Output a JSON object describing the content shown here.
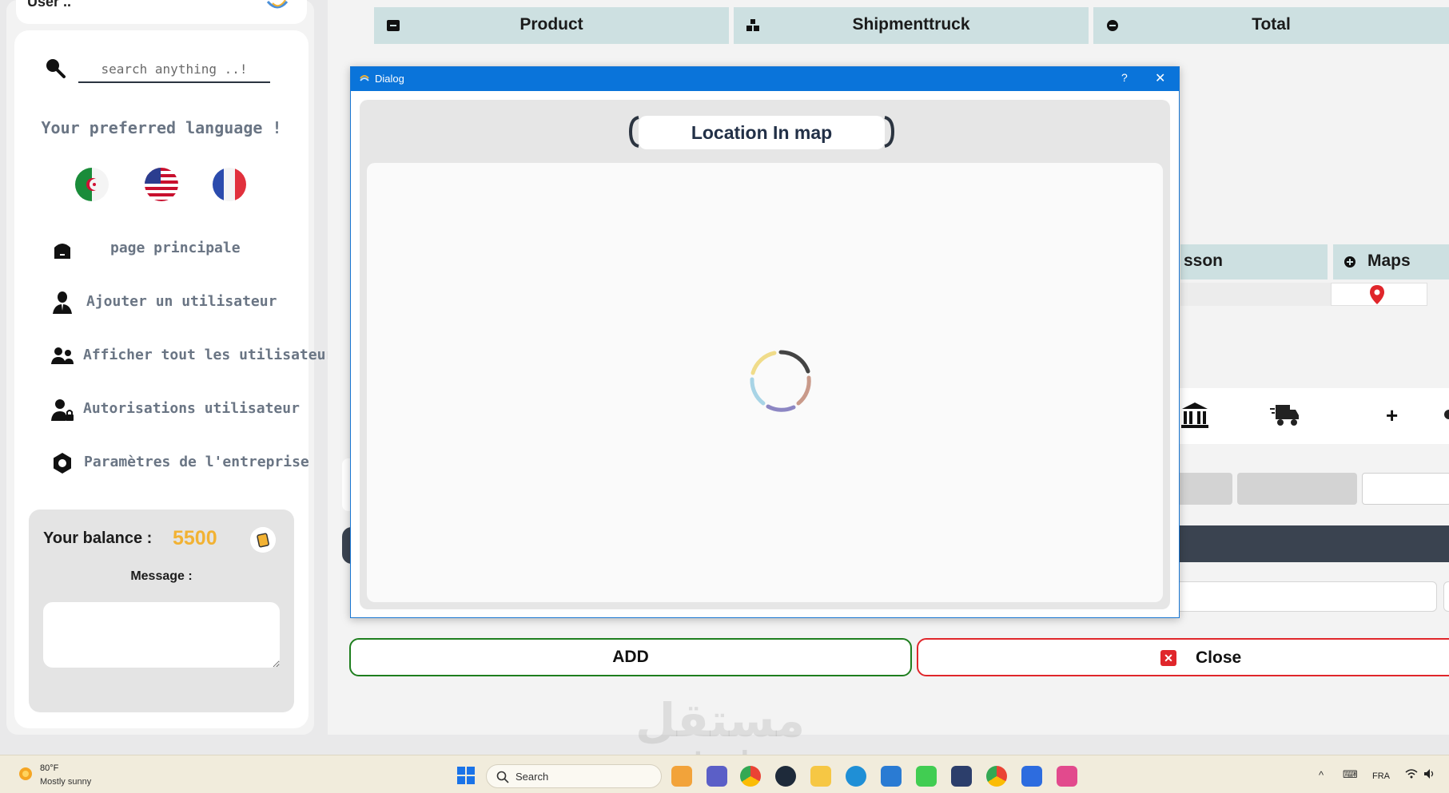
{
  "sidebar": {
    "user_label": "User ..",
    "search_placeholder": "search anything ..!",
    "language_title": "Your preferred language !",
    "languages": [
      "Algeria (Arabic)",
      "United States (English)",
      "France (French)"
    ],
    "items": [
      {
        "label": "page principale",
        "icon": "home-icon"
      },
      {
        "label": "Ajouter un utilisateur",
        "icon": "add-user-icon"
      },
      {
        "label": "Afficher tout les utilisateurs",
        "icon": "users-icon"
      },
      {
        "label": "Autorisations utilisateur",
        "icon": "user-lock-icon"
      },
      {
        "label": "Paramètres de l'entreprise",
        "icon": "settings-icon"
      }
    ],
    "balance_label": "Your balance :",
    "balance_value": "5500",
    "message_label": "Message :"
  },
  "main": {
    "tabs": [
      {
        "label": "Product",
        "icon": "archive-icon"
      },
      {
        "label": "Shipmenttruck",
        "icon": "boxes-icon"
      },
      {
        "label": "Total",
        "icon": "minus-circle-icon"
      }
    ],
    "table_headers": [
      {
        "label": "sson"
      },
      {
        "label": "Maps",
        "icon": "plus-circle-icon"
      }
    ],
    "plus_label": "+",
    "add_button": "ADD",
    "close_button": "Close"
  },
  "dialog": {
    "window_title": "Dialog",
    "help": "?",
    "close": "✕",
    "heading": "Location In map"
  },
  "taskbar": {
    "weather_temp": "80°F",
    "weather_desc": "Mostly sunny",
    "search_label": "Search",
    "tray_chevron": "^",
    "tray_lang": "FRA"
  },
  "watermark": {
    "arabic": "مستقل",
    "latin": "mostaql.com"
  },
  "colors": {
    "accent_blue": "#0a74da",
    "tab_bg": "#cde0e1",
    "balance": "#f2b233",
    "add_border": "#1e7e1e",
    "close_border": "#e0262b",
    "dark_bar": "#3a4350"
  }
}
